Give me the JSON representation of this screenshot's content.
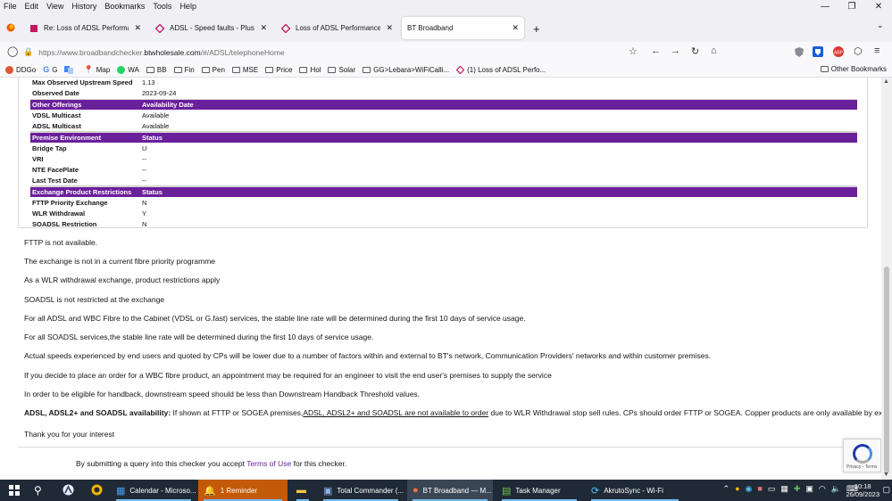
{
  "menu": [
    "File",
    "Edit",
    "View",
    "History",
    "Bookmarks",
    "Tools",
    "Help"
  ],
  "window_controls": {
    "minimize": "—",
    "maximize": "❐",
    "close": "✕"
  },
  "tabs": [
    {
      "title": "Re: Loss of ADSL Performance A",
      "active": false
    },
    {
      "title": "ADSL - Speed faults - Plusnet C",
      "active": false
    },
    {
      "title": "Loss of ADSL Performance Afte",
      "active": false
    },
    {
      "title": "BT Broadband",
      "active": true
    }
  ],
  "url": {
    "prefix": "https://www.broadbandchecker.",
    "domain": "btwholesale.com",
    "path": "/#/ADSL/telephoneHome"
  },
  "bookmarks": [
    {
      "label": "DDGo",
      "icon": "duck-icon"
    },
    {
      "label": "G",
      "icon": "google-icon"
    },
    {
      "label": "",
      "icon": "translate-icon"
    },
    {
      "label": "Map",
      "icon": "map-pin-icon"
    },
    {
      "label": "WA",
      "icon": "whatsapp-icon"
    },
    {
      "label": "BB",
      "icon": "folder-icon"
    },
    {
      "label": "Fin",
      "icon": "folder-icon"
    },
    {
      "label": "Pen",
      "icon": "folder-icon"
    },
    {
      "label": "MSE",
      "icon": "folder-icon"
    },
    {
      "label": "Price",
      "icon": "folder-icon"
    },
    {
      "label": "Hol",
      "icon": "folder-icon"
    },
    {
      "label": "Solar",
      "icon": "folder-icon"
    },
    {
      "label": "GG>Lebara>WiFiCalli...",
      "icon": "folder-icon"
    },
    {
      "label": "(1) Loss of ADSL Perfo...",
      "icon": "plusnet-icon"
    }
  ],
  "other_bookmarks": "Other Bookmarks",
  "table": {
    "top_rows": [
      {
        "k": "Max Observed Upstream Speed",
        "v": "1.13"
      },
      {
        "k": "Observed Date",
        "v": "2023-09-24"
      }
    ],
    "sections": [
      {
        "header": [
          "Other Offerings",
          "Availability Date"
        ],
        "rows": [
          {
            "k": "VDSL Multicast",
            "v": "Available"
          },
          {
            "k": "ADSL Multicast",
            "v": "Available"
          }
        ]
      },
      {
        "header": [
          "Premise Environment",
          "Status"
        ],
        "rows": [
          {
            "k": "Bridge Tap",
            "v": "U"
          },
          {
            "k": "VRI",
            "v": "--"
          },
          {
            "k": "NTE FacePlate",
            "v": "--"
          },
          {
            "k": "Last Test Date",
            "v": "--"
          }
        ]
      },
      {
        "header": [
          "Exchange Product Restrictions",
          "Status"
        ],
        "rows": [
          {
            "k": "FTTP Priority Exchange",
            "v": "N"
          },
          {
            "k": "WLR Withdrawal",
            "v": "Y"
          },
          {
            "k": "SOADSL Restriction",
            "v": "N"
          }
        ]
      }
    ]
  },
  "messages": [
    "FTTP is not available.",
    "The exchange is not in a current fibre priority programme",
    "As a WLR withdrawal exchange, product restrictions apply",
    "SOADSL is not restricted at the exchange",
    "For all ADSL and WBC Fibre to the Cabinet (VDSL or G.fast) services, the stable line rate will be determined during the first 10 days of service usage.",
    "For all SOADSL services,the stable line rate will be determined during the first 10 days of service usage.",
    "Actual speeds experienced by end users and quoted by CPs will be lower due to a number of factors within and external to BT's network, Communication Providers' networks and within customer premises.",
    "If you decide to place an order for a WBC fibre product, an appointment may be required for an engineer to visit the end user's premises to supply the service",
    "In order to be eligible for handback, downstream speed should be less than Downstream Handback Threshold values."
  ],
  "availability": {
    "label": "ADSL, ADSL2+ and SOADSL availability:",
    "text1": " If shown at FTTP or SOGEA premises,",
    "underlined": "ADSL, ADSL2+ and SOADSL are not available to order",
    "text2": " due to WLR Withdrawal stop sell rules. CPs should order FTTP or SOGEA. Copper products are only available by exception."
  },
  "thanks": "Thank you for your interest",
  "terms": {
    "before": "By submitting a query into this checker you accept ",
    "link": "Terms of Use",
    "after": " for this checker."
  },
  "taskbar": {
    "apps": [
      {
        "label": "Calendar - Microso...",
        "icon": "calendar-icon",
        "state": "normal"
      },
      {
        "label": "1 Reminder",
        "icon": "bell-icon",
        "state": "reminder"
      },
      {
        "label": "",
        "icon": "file-explorer-icon",
        "state": "normal"
      },
      {
        "label": "Total Commander (...",
        "icon": "total-commander-icon",
        "state": "normal"
      },
      {
        "label": "BT Broadband — M...",
        "icon": "firefox-icon",
        "state": "active"
      },
      {
        "label": "Task Manager",
        "icon": "task-manager-icon",
        "state": "normal"
      },
      {
        "label": "AkrutoSync - Wi-Fi",
        "icon": "sync-icon",
        "state": "normal"
      }
    ],
    "time": "10:18",
    "date": "26/09/2023"
  }
}
